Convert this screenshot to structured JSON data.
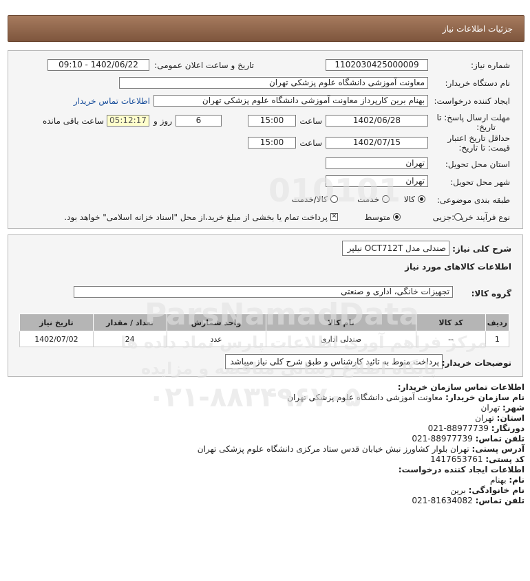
{
  "title": "جزئیات اطلاعات نیاز",
  "fields": {
    "need_number_label": "شماره نیاز:",
    "need_number": "1102030425000009",
    "announce_label": "تاریخ و ساعت اعلان عمومی:",
    "announce_value": "1402/06/22 - 09:10",
    "buyer_org_label": "نام دستگاه خریدار:",
    "buyer_org": "معاونت آموزشی دانشگاه علوم پزشکی تهران",
    "creator_label": "ایجاد کننده درخواست:",
    "creator": "بهنام برین کارپرداز معاونت آموزشی دانشگاه علوم پزشکی تهران",
    "contact_link": "اطلاعات تماس خریدار",
    "deadline_label_1": "مهلت ارسال پاسخ: تا",
    "deadline_label_2": "تاریخ:",
    "deadline_date": "1402/06/28",
    "time_label": "ساعت",
    "deadline_time": "15:00",
    "days_value": "6",
    "days_label": "روز و",
    "remaining_time": "05:12:17",
    "remaining_label": "ساعت باقی مانده",
    "validity_label_1": "حداقل تاریخ اعتبار",
    "validity_label_2": "قیمت: تا تاریخ:",
    "validity_date": "1402/07/15",
    "validity_time": "15:00",
    "province_label": "استان محل تحویل:",
    "province": "تهران",
    "city_label": "شهر محل تحویل:",
    "city": "تهران",
    "category_label": "طبقه بندی موضوعی:",
    "category_options": [
      "کالا",
      "خدمت",
      "کالا/خدمت"
    ],
    "category_selected": "کالا",
    "process_label": "نوع فرآیند خرید :",
    "process_options": [
      "جزیی",
      "متوسط"
    ],
    "process_selected": "متوسط",
    "payment_note": "پرداخت تمام یا بخشی از مبلغ خرید،از محل \"اسناد خزانه اسلامی\" خواهد بود."
  },
  "description": {
    "label": "شرح کلی نیاز:",
    "value": "صندلی مدل OCT712T نیلپر",
    "goods_info_title": "اطلاعات کالاهای مورد نیاز",
    "goods_group_label": "گروه کالا:",
    "goods_group": "تجهیزات خانگی، اداری و صنعتی"
  },
  "table": {
    "headers": [
      "ردیف",
      "کد کالا",
      "نام کالا",
      "واحد شمارش",
      "تعداد / مقدار",
      "تاریخ نیاز"
    ],
    "rows": [
      [
        "1",
        "--",
        "صندلی اداری",
        "عدد",
        "24",
        "1402/07/02"
      ]
    ]
  },
  "buyer_notes": {
    "label": "توضیحات خریدار:",
    "value": "پرداخت منوط به تائید کارشناس و طبق شرح کلی نیاز میباشد"
  },
  "contact": {
    "title": "اطلاعات تماس سازمان خریدار:",
    "org_label": "نام سازمان خریدار:",
    "org": "معاونت آموزشی دانشگاه علوم پزشکی تهران",
    "city_label": "شهر:",
    "city": "تهران",
    "province_label": "استان:",
    "province": "تهران",
    "fax_label": "دورنگار:",
    "fax": "021-88977739",
    "phone_label": "تلفن تماس:",
    "phone": "021-88977739",
    "address_label": "آدرس پستی:",
    "address": "تهران بلوار کشاورز نبش خیابان قدس ستاد مرکزی دانشگاه علوم پزشکی تهران",
    "postal_label": "کد پستی:",
    "postal": "1417653761",
    "creator_title": "اطلاعات ایجاد کننده درخواست:",
    "name_label": "نام:",
    "name": "بهنام",
    "family_label": "نام خانوادگی:",
    "family": "برین",
    "creator_phone_label": "تلفن تماس:",
    "creator_phone": "021-81634082"
  },
  "watermark": {
    "site": "ParsNamadData",
    "line1": "مرکز فراهم آوری اطلاعات پارس نماد داده ها",
    "line2": "پایگاه اطلاع رسانی مناقصه و مزایده",
    "phone": "۰۲۱-۸۸۳۴۹۶۷۰۵",
    "digits": "010101"
  }
}
